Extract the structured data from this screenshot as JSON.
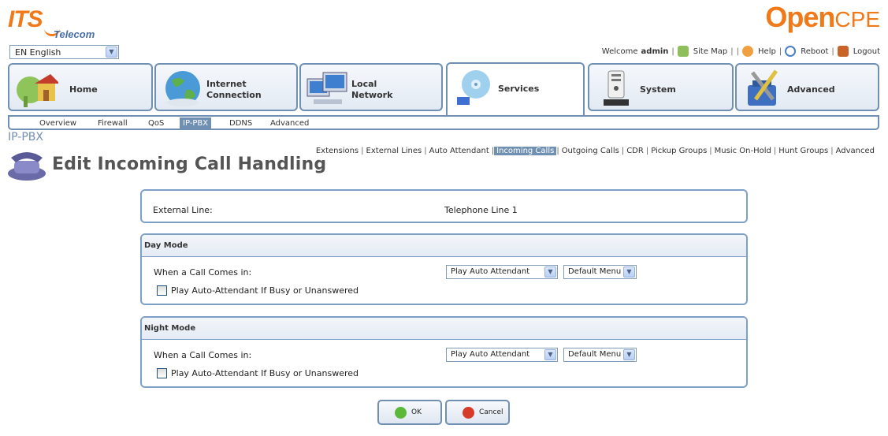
{
  "brand": {
    "its_main": "ITS",
    "its_sub": "Telecom",
    "opencpe_open": "Open",
    "opencpe_cpe": "CPE"
  },
  "language": {
    "selected": "EN English"
  },
  "top_links": {
    "welcome_prefix": "Welcome",
    "user": "admin",
    "site_map": "Site Map",
    "help": "Help",
    "reboot": "Reboot",
    "logout": "Logout"
  },
  "main_tabs": [
    {
      "label": "Home",
      "icon": "house-icon"
    },
    {
      "label": "Internet Connection",
      "icon": "globe-icon"
    },
    {
      "label": "Local Network",
      "icon": "computers-icon"
    },
    {
      "label": "Services",
      "icon": "disc-icon",
      "active": true
    },
    {
      "label": "System",
      "icon": "router-icon"
    },
    {
      "label": "Advanced",
      "icon": "tools-icon"
    }
  ],
  "sub_nav": [
    "Overview",
    "Firewall",
    "QoS",
    "IP-PBX",
    "DDNS",
    "Advanced"
  ],
  "sub_nav_active": "IP-PBX",
  "section_label": "IP-PBX",
  "pbx_links": [
    "Extensions",
    "External Lines",
    "Auto Attendant",
    "Incoming Calls",
    "Outgoing Calls",
    "CDR",
    "Pickup Groups",
    "Music On-Hold",
    "Hunt Groups",
    "Advanced"
  ],
  "pbx_links_active": "Incoming Calls",
  "page_title": "Edit Incoming Call Handling",
  "external_line": {
    "label": "External Line:",
    "value": "Telephone Line 1"
  },
  "day_mode": {
    "title": "Day Mode",
    "call_label": "When a Call Comes in:",
    "action": "Play Auto Attendant",
    "menu": "Default Menu",
    "checkbox_label": "Play Auto-Attendant If Busy or Unanswered",
    "checked": false
  },
  "night_mode": {
    "title": "Night Mode",
    "call_label": "When a Call Comes in:",
    "action": "Play Auto Attendant",
    "menu": "Default Menu",
    "checkbox_label": "Play Auto-Attendant If Busy or Unanswered",
    "checked": false
  },
  "buttons": {
    "ok": "OK",
    "cancel": "Cancel"
  },
  "colors": {
    "accent": "#f07a1a",
    "frame": "#6f8fb3",
    "active_bg": "#6f8fb3"
  }
}
